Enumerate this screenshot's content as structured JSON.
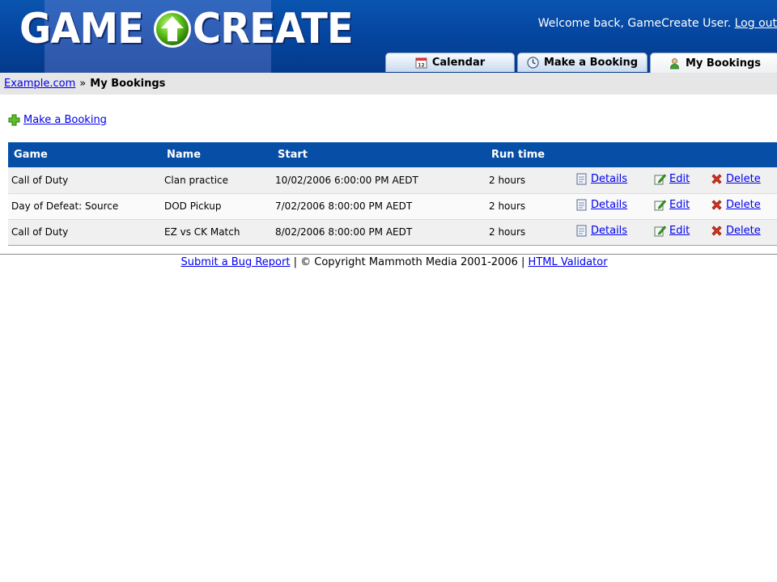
{
  "header": {
    "logo_word1": "GAME",
    "logo_word2": "CREATE",
    "welcome_text": "Welcome back, GameCreate User.",
    "logout_label": "Log out"
  },
  "tabs": [
    {
      "label": "Calendar",
      "icon": "calendar-icon",
      "active": false
    },
    {
      "label": "Make a Booking",
      "icon": "clock-icon",
      "active": false
    },
    {
      "label": "My Bookings",
      "icon": "user-icon",
      "active": true
    }
  ],
  "breadcrumb": {
    "home": "Example.com",
    "separator": "»",
    "current": "My Bookings"
  },
  "make_booking_link": "Make a Booking",
  "table": {
    "columns": [
      "Game",
      "Name",
      "Start",
      "Run time"
    ],
    "rows": [
      {
        "game": "Call of Duty",
        "name": "Clan practice",
        "start": "10/02/2006 6:00:00 PM AEDT",
        "runtime": "2 hours"
      },
      {
        "game": "Day of Defeat: Source",
        "name": "DOD Pickup",
        "start": "7/02/2006 8:00:00 PM AEDT",
        "runtime": "2 hours"
      },
      {
        "game": "Call of Duty",
        "name": "EZ vs CK Match",
        "start": "8/02/2006 8:00:00 PM AEDT",
        "runtime": "2 hours"
      }
    ],
    "actions": {
      "details": "Details",
      "edit": "Edit",
      "delete": "Delete"
    }
  },
  "footer": {
    "bug_report": "Submit a Bug Report",
    "sep": "|",
    "copyright": "© Copyright Mammoth Media 2001-2006",
    "validator": "HTML Validator"
  },
  "colors": {
    "header_blue": "#0546a0",
    "table_header": "#064ea6",
    "link": "#0000ee",
    "breadcrumb_bg": "#e6e6e6"
  }
}
